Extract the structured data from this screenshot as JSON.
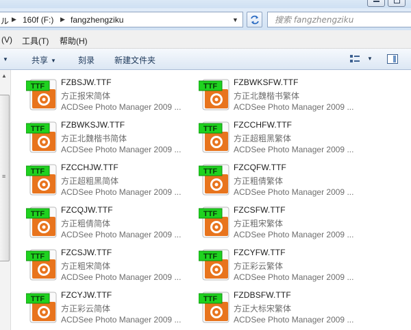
{
  "window": {
    "minimize_icon": "minimize-icon",
    "maximize_icon": "maximize-icon"
  },
  "address": {
    "crumbs": [
      "ル",
      "160f (F:)",
      "fangzhengziku"
    ],
    "refresh_icon": "refresh-icon"
  },
  "search": {
    "placeholder": "搜索 fangzhengziku"
  },
  "menu": {
    "items": [
      "(V)",
      "工具(T)",
      "帮助(H)"
    ]
  },
  "toolbar": {
    "share_label": "共享",
    "burn_label": "刻录",
    "new_folder_label": "新建文件夹",
    "views_icon": "views-icon",
    "preview_pane_icon": "preview-pane-icon"
  },
  "files": [
    {
      "name": "FZBSJW.TTF",
      "desc": "方正报宋简体",
      "app": "ACDSee Photo Manager 2009 ...",
      "badge": "TTF"
    },
    {
      "name": "FZBWKSFW.TTF",
      "desc": "方正北魏楷书繁体",
      "app": "ACDSee Photo Manager 2009 ...",
      "badge": "TTF"
    },
    {
      "name": "FZBWKSJW.TTF",
      "desc": "方正北魏楷书简体",
      "app": "ACDSee Photo Manager 2009 ...",
      "badge": "TTF"
    },
    {
      "name": "FZCCHFW.TTF",
      "desc": "方正超粗黑繁体",
      "app": "ACDSee Photo Manager 2009 ...",
      "badge": "TTF"
    },
    {
      "name": "FZCCHJW.TTF",
      "desc": "方正超粗黑简体",
      "app": "ACDSee Photo Manager 2009 ...",
      "badge": "TTF"
    },
    {
      "name": "FZCQFW.TTF",
      "desc": "方正粗倩繁体",
      "app": "ACDSee Photo Manager 2009 ...",
      "badge": "TTF"
    },
    {
      "name": "FZCQJW.TTF",
      "desc": "方正粗倩简体",
      "app": "ACDSee Photo Manager 2009 ...",
      "badge": "TTF"
    },
    {
      "name": "FZCSFW.TTF",
      "desc": "方正粗宋繁体",
      "app": "ACDSee Photo Manager 2009 ...",
      "badge": "TTF"
    },
    {
      "name": "FZCSJW.TTF",
      "desc": "方正粗宋简体",
      "app": "ACDSee Photo Manager 2009 ...",
      "badge": "TTF"
    },
    {
      "name": "FZCYFW.TTF",
      "desc": "方正彩云繁体",
      "app": "ACDSee Photo Manager 2009 ...",
      "badge": "TTF"
    },
    {
      "name": "FZCYJW.TTF",
      "desc": "方正彩云简体",
      "app": "ACDSee Photo Manager 2009 ...",
      "badge": "TTF"
    },
    {
      "name": "FZDBSFW.TTF",
      "desc": "方正大标宋繁体",
      "app": "ACDSee Photo Manager 2009 ...",
      "badge": "TTF"
    }
  ],
  "colors": {
    "badge_green": "#1fd21f",
    "icon_orange": "#e8741d"
  }
}
